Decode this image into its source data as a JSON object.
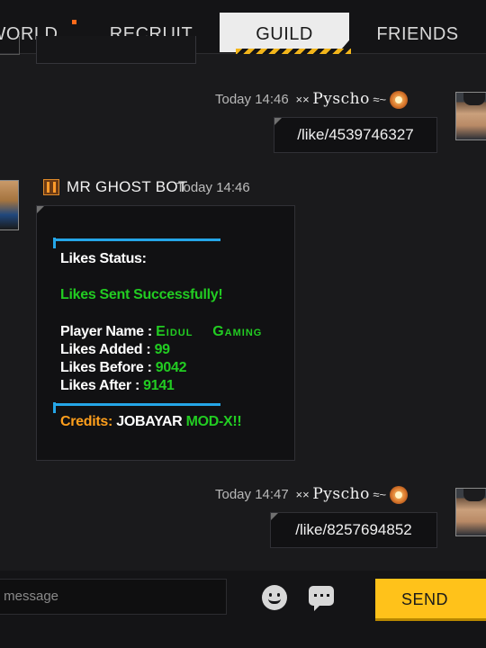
{
  "tabs": [
    {
      "label": "WORLD",
      "active": false
    },
    {
      "label": "RECRUIT",
      "active": false
    },
    {
      "label": "GUILD",
      "active": true
    },
    {
      "label": "FRIENDS",
      "active": false
    }
  ],
  "colors": {
    "accent": "#ffc21a",
    "success": "#22cc22",
    "credits": "#ff9f1c",
    "divider": "#25a6e8"
  },
  "messages": [
    {
      "time": "Today 14:46",
      "username": "Pyscho",
      "text": "/like/4539746327"
    },
    {
      "time": "Today 14:47",
      "username": "Pyscho",
      "text": "/like/8257694852"
    }
  ],
  "bot": {
    "name": "MR GHOST BOT",
    "time": "Today 14:46",
    "status_label": "Likes Status:",
    "success_text": "Likes Sent Successfully!",
    "player_name_label": "Player Name :",
    "player_name_value": "Eidul    Gaming",
    "likes_added_label": "Likes Added :",
    "likes_added_value": "99",
    "likes_before_label": "Likes Before :",
    "likes_before_value": "9042",
    "likes_after_label": "Likes After :",
    "likes_after_value": "9141",
    "credits_label": "Credits:",
    "credits_name": "JOBAYAR",
    "credits_mod": "MOD-X!!"
  },
  "composer": {
    "placeholder": "r message",
    "send_label": "SEND"
  },
  "icons": [
    "emoji-icon",
    "quick-chat-icon",
    "rank-badge-icon",
    "bot-logo-icon"
  ]
}
